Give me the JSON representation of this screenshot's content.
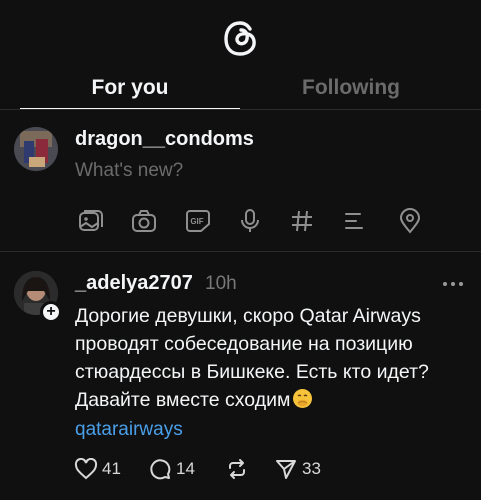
{
  "app": {
    "logo": "threads-logo"
  },
  "tabs": [
    {
      "label": "For you",
      "active": true
    },
    {
      "label": "Following",
      "active": false
    }
  ],
  "composer": {
    "username": "dragon__condoms",
    "placeholder": "What's new?",
    "attachments": [
      "gallery-icon",
      "camera-icon",
      "gif-icon",
      "microphone-icon",
      "hashtag-icon",
      "poll-icon",
      "location-icon"
    ]
  },
  "post": {
    "username": "_adelya2707",
    "time": "10h",
    "text": "Дорогие девушки, скоро Qatar Airways проводят собеседование на позицию стюардессы в Бишкеке. Есть кто идет? Давайте вместе сходим",
    "emoji": "🤭",
    "tag": "qatarairways",
    "likes": "41",
    "replies": "14",
    "reposts": "",
    "shares": "33"
  },
  "colors": {
    "background": "#101010",
    "text": "#f3f5f7",
    "muted": "#6b6b6b",
    "link": "#4a9fe8"
  }
}
